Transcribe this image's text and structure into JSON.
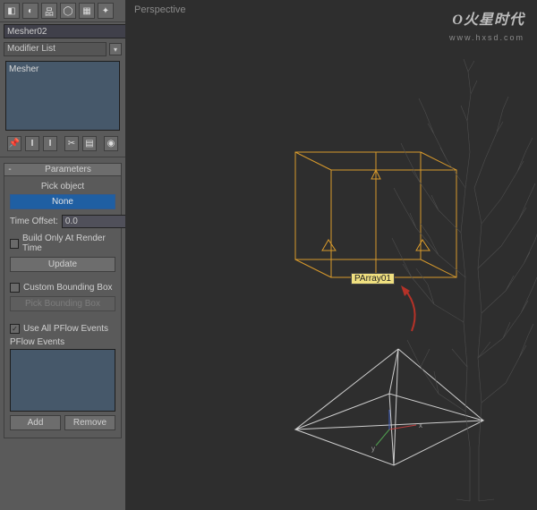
{
  "viewport": {
    "label": "Perspective",
    "node_label": "PArray01"
  },
  "watermark": {
    "logo": "火星时代",
    "prefix": "O",
    "url": "www.hxsd.com"
  },
  "header": {
    "name": "Mesher02",
    "modifier_list_label": "Modifier List",
    "stack_item": "Mesher"
  },
  "params": {
    "rollout_title": "Parameters",
    "pick_object_label": "Pick object",
    "pick_object_btn": "None",
    "time_offset_label": "Time Offset:",
    "time_offset_value": "0.0",
    "build_render_label": "Build Only At Render Time",
    "build_render_checked": false,
    "update_btn": "Update",
    "custom_bbox_label": "Custom Bounding Box",
    "custom_bbox_checked": false,
    "pick_bbox_btn": "Pick Bounding Box",
    "use_pflow_label": "Use All PFlow Events",
    "use_pflow_checked": true,
    "pflow_events_label": "PFlow Events",
    "add_btn": "Add",
    "remove_btn": "Remove"
  }
}
